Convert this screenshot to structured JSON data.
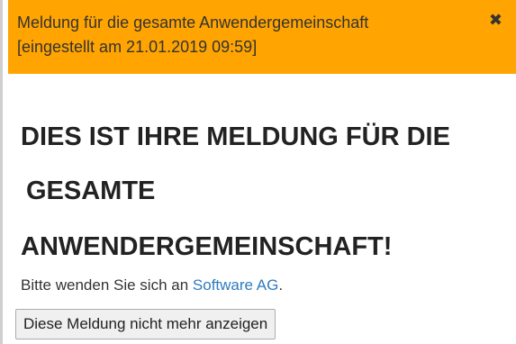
{
  "banner": {
    "title": "Meldung für die gesamte Anwendergemeinschaft",
    "timestamp_line": "[eingestellt am 21.01.2019 09:59]",
    "close_label": "✖",
    "background_color": "#ffa400"
  },
  "message": {
    "headline_line1": "DIES IST IHRE MELDUNG FÜR DIE",
    "headline_line2": "GESAMTE",
    "headline_line3": "ANWENDERGEMEINSCHAFT!",
    "contact_prefix": "Bitte wenden Sie sich an ",
    "contact_link": "Software AG",
    "contact_suffix": ".",
    "link_color": "#2e7bbf"
  },
  "actions": {
    "dismiss_label": "Diese Meldung nicht mehr anzeigen"
  }
}
